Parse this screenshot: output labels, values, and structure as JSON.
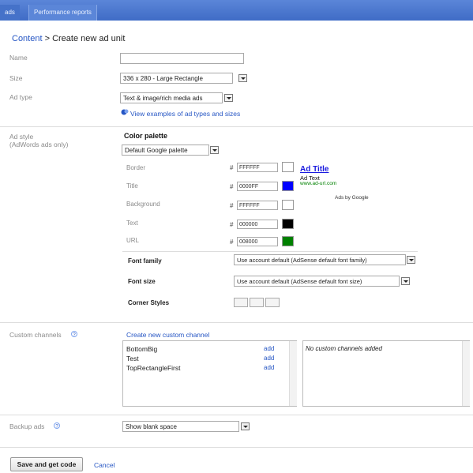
{
  "topbar": {
    "tabs": [
      "ads",
      "Performance reports"
    ]
  },
  "breadcrumb": {
    "link": "Content",
    "sep": " > ",
    "current": "Create new ad unit"
  },
  "labels": {
    "name": "Name",
    "size": "Size",
    "adtype": "Ad type",
    "adstyle": "Ad style",
    "adstyle_sub": "(AdWords ads only)",
    "custom": "Custom channels",
    "backup": "Backup ads"
  },
  "size": {
    "value": "336 x 280 - Large Rectangle"
  },
  "adtype": {
    "value": "Text & image/rich media ads",
    "link": "View examples of ad types and sizes"
  },
  "palette": {
    "title": "Color palette",
    "select": "Default Google palette",
    "rows": [
      {
        "label": "Border",
        "hex": "FFFFFF",
        "color": "#ffffff"
      },
      {
        "label": "Title",
        "hex": "0000FF",
        "color": "#0000ff"
      },
      {
        "label": "Background",
        "hex": "FFFFFF",
        "color": "#ffffff"
      },
      {
        "label": "Text",
        "hex": "000000",
        "color": "#000000"
      },
      {
        "label": "URL",
        "hex": "008000",
        "color": "#008000"
      }
    ],
    "hash": "#"
  },
  "preview": {
    "title": "Ad Title",
    "text": "Ad Text",
    "url": "www.ad-url.com",
    "by": "Ads by Google"
  },
  "font": {
    "family_label": "Font family",
    "family_value": "Use account default (AdSense default font family)",
    "size_label": "Font size",
    "size_value": "Use account default (AdSense default font size)",
    "corner_label": "Corner Styles"
  },
  "channels": {
    "create_link": "Create new custom channel",
    "items": [
      "BottomBig",
      "Test",
      "TopRectangleFirst"
    ],
    "add": "add",
    "empty": "No custom channels added"
  },
  "backup": {
    "value": "Show blank space"
  },
  "footer": {
    "save": "Save and get code",
    "cancel": "Cancel"
  }
}
